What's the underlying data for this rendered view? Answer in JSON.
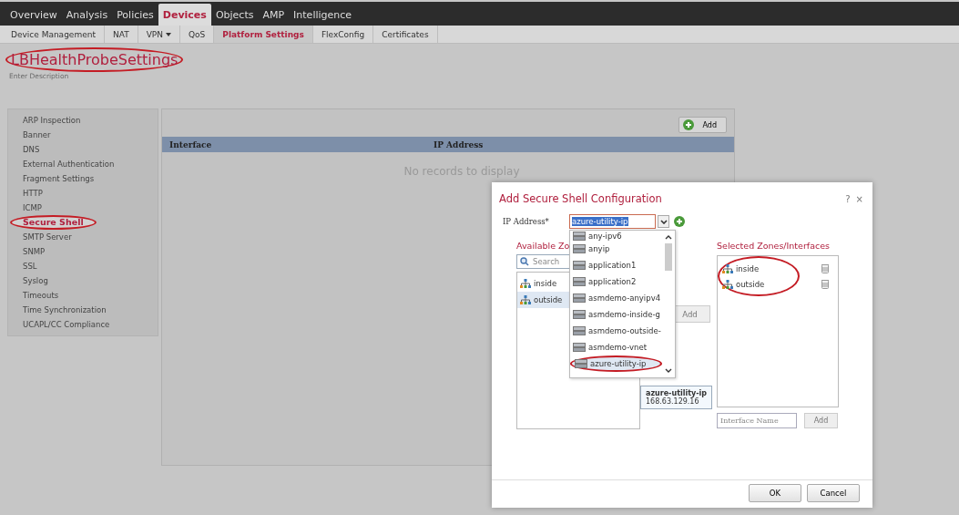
{
  "nav_tabs": [
    {
      "label": "Overview",
      "selected": false
    },
    {
      "label": "Analysis",
      "selected": false
    },
    {
      "label": "Policies",
      "selected": false
    },
    {
      "label": "Devices",
      "selected": true
    },
    {
      "label": "Objects",
      "selected": false
    },
    {
      "label": "AMP",
      "selected": false
    },
    {
      "label": "Intelligence",
      "selected": false
    }
  ],
  "sub_tabs": [
    {
      "label": "Device Management",
      "selected": false,
      "has_menu": false
    },
    {
      "label": "NAT",
      "selected": false,
      "has_menu": false
    },
    {
      "label": "VPN",
      "selected": false,
      "has_menu": true
    },
    {
      "label": "QoS",
      "selected": false,
      "has_menu": false
    },
    {
      "label": "Platform Settings",
      "selected": true,
      "has_menu": false
    },
    {
      "label": "FlexConfig",
      "selected": false,
      "has_menu": false
    },
    {
      "label": "Certificates",
      "selected": false,
      "has_menu": false
    }
  ],
  "policy": {
    "title": "LBHealthProbeSettings",
    "annotated": true,
    "description_placeholder": "Enter Description"
  },
  "sidebar": {
    "items": [
      {
        "label": "ARP Inspection",
        "selected": false,
        "annotated": false
      },
      {
        "label": "Banner",
        "selected": false,
        "annotated": false
      },
      {
        "label": "DNS",
        "selected": false,
        "annotated": false
      },
      {
        "label": "External Authentication",
        "selected": false,
        "annotated": false
      },
      {
        "label": "Fragment Settings",
        "selected": false,
        "annotated": false
      },
      {
        "label": "HTTP",
        "selected": false,
        "annotated": false
      },
      {
        "label": "ICMP",
        "selected": false,
        "annotated": false
      },
      {
        "label": "Secure Shell",
        "selected": true,
        "annotated": true
      },
      {
        "label": "SMTP Server",
        "selected": false,
        "annotated": false
      },
      {
        "label": "SNMP",
        "selected": false,
        "annotated": false
      },
      {
        "label": "SSL",
        "selected": false,
        "annotated": false
      },
      {
        "label": "Syslog",
        "selected": false,
        "annotated": false
      },
      {
        "label": "Timeouts",
        "selected": false,
        "annotated": false
      },
      {
        "label": "Time Synchronization",
        "selected": false,
        "annotated": false
      },
      {
        "label": "UCAPL/CC Compliance",
        "selected": false,
        "annotated": false
      }
    ]
  },
  "table": {
    "add_button": "Add",
    "columns": [
      "Interface",
      "IP Address"
    ],
    "empty_message": "No records to display"
  },
  "dialog": {
    "title": "Add Secure Shell Configuration",
    "help": "?",
    "close": "×",
    "ip_label": "IP Address*",
    "ip_value": "azure-utility-ip",
    "dropdown": [
      {
        "label": "any-ipv6",
        "selected": false,
        "annotated": false
      },
      {
        "label": "anyip",
        "selected": false,
        "annotated": false
      },
      {
        "label": "application1",
        "selected": false,
        "annotated": false
      },
      {
        "label": "application2",
        "selected": false,
        "annotated": false
      },
      {
        "label": "asmdemo-anyipv4",
        "selected": false,
        "annotated": false
      },
      {
        "label": "asmdemo-inside-g",
        "selected": false,
        "annotated": false
      },
      {
        "label": "asmdemo-outside-",
        "selected": false,
        "annotated": false
      },
      {
        "label": "asmdemo-vnet",
        "selected": false,
        "annotated": false
      },
      {
        "label": "azure-utility-ip",
        "selected": true,
        "annotated": true
      }
    ],
    "tooltip": {
      "name": "azure-utility-ip",
      "address": "168.63.129.16"
    },
    "available_heading": "Available Zo",
    "search_placeholder": "Search",
    "available": [
      {
        "label": "inside",
        "selected": false
      },
      {
        "label": "outside",
        "selected": true
      }
    ],
    "add_button": "Add",
    "selected_heading": "Selected Zones/Interfaces",
    "selected_annotated": true,
    "selected": [
      {
        "label": "inside"
      },
      {
        "label": "outside"
      }
    ],
    "interface_placeholder": "Interface Name",
    "interface_add": "Add",
    "ok": "OK",
    "cancel": "Cancel"
  }
}
